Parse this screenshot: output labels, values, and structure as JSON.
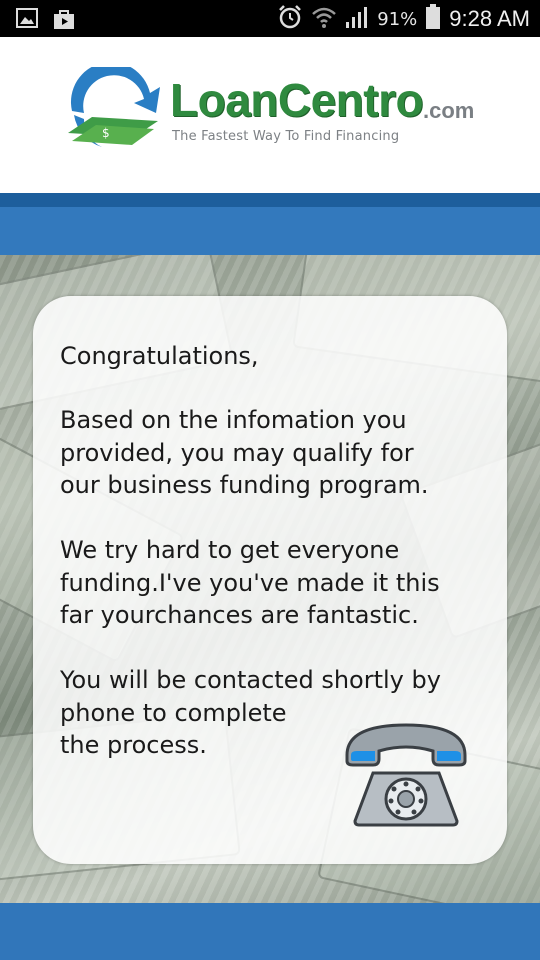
{
  "status_bar": {
    "battery_percent": "91%",
    "time": "9:28 AM",
    "icons": [
      "image-notification-icon",
      "store-notification-icon",
      "alarm-icon",
      "wifi-icon",
      "signal-icon",
      "battery-icon"
    ]
  },
  "header": {
    "brand_name": "LoanCentro",
    "brand_domain": ".com",
    "tagline": "The Fastest Way To Find Financing"
  },
  "message": {
    "greeting": "Congratulations,",
    "paragraph_1": "Based on the infomation you\nprovided, you may qualify for\nour business funding program.",
    "paragraph_2": "We try hard to get everyone\nfunding.I've you've made it this\nfar yourchances are fantastic.",
    "paragraph_3": "You will be contacted shortly by\nphone to complete\nthe process."
  },
  "colors": {
    "brand_green": "#2f8a3f",
    "brand_blue": "#2a7ec4",
    "bar_blue": "#3176ba",
    "bar_dark_blue": "#1d5e9c"
  }
}
